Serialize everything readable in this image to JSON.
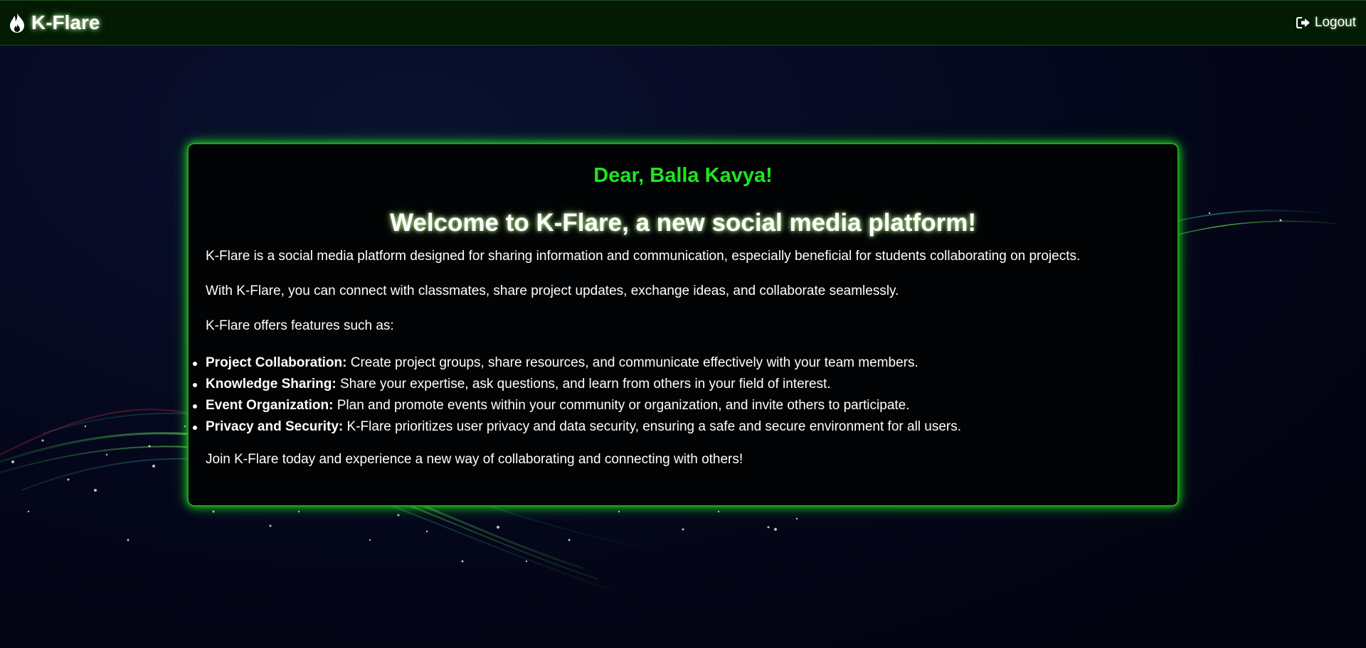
{
  "app": {
    "brand": "K-Flare",
    "brand_icon": "flame-icon",
    "logout_label": "Logout",
    "logout_icon": "sign-out-icon"
  },
  "colors": {
    "navbar_bg": "#031a03",
    "accent_green": "#1ee61e",
    "card_border": "#1aa31a",
    "card_bg": "#020305"
  },
  "card": {
    "greeting": "Dear, Balla Kavya!",
    "welcome": "Welcome to K-Flare, a new social media platform!",
    "intro": "K-Flare is a social media platform designed for sharing information and communication, especially beneficial for students collaborating on projects.",
    "connect": "With K-Flare, you can connect with classmates, share project updates, exchange ideas, and collaborate seamlessly.",
    "features_intro": "K-Flare offers features such as:",
    "features": [
      {
        "title": "Project Collaboration:",
        "text": " Create project groups, share resources, and communicate effectively with your team members."
      },
      {
        "title": "Knowledge Sharing:",
        "text": " Share your expertise, ask questions, and learn from others in your field of interest."
      },
      {
        "title": "Event Organization:",
        "text": " Plan and promote events within your community or organization, and invite others to participate."
      },
      {
        "title": "Privacy and Security:",
        "text": " K-Flare prioritizes user privacy and data security, ensuring a safe and secure environment for all users."
      }
    ],
    "closing": "Join K-Flare today and experience a new way of collaborating and connecting with others!"
  }
}
